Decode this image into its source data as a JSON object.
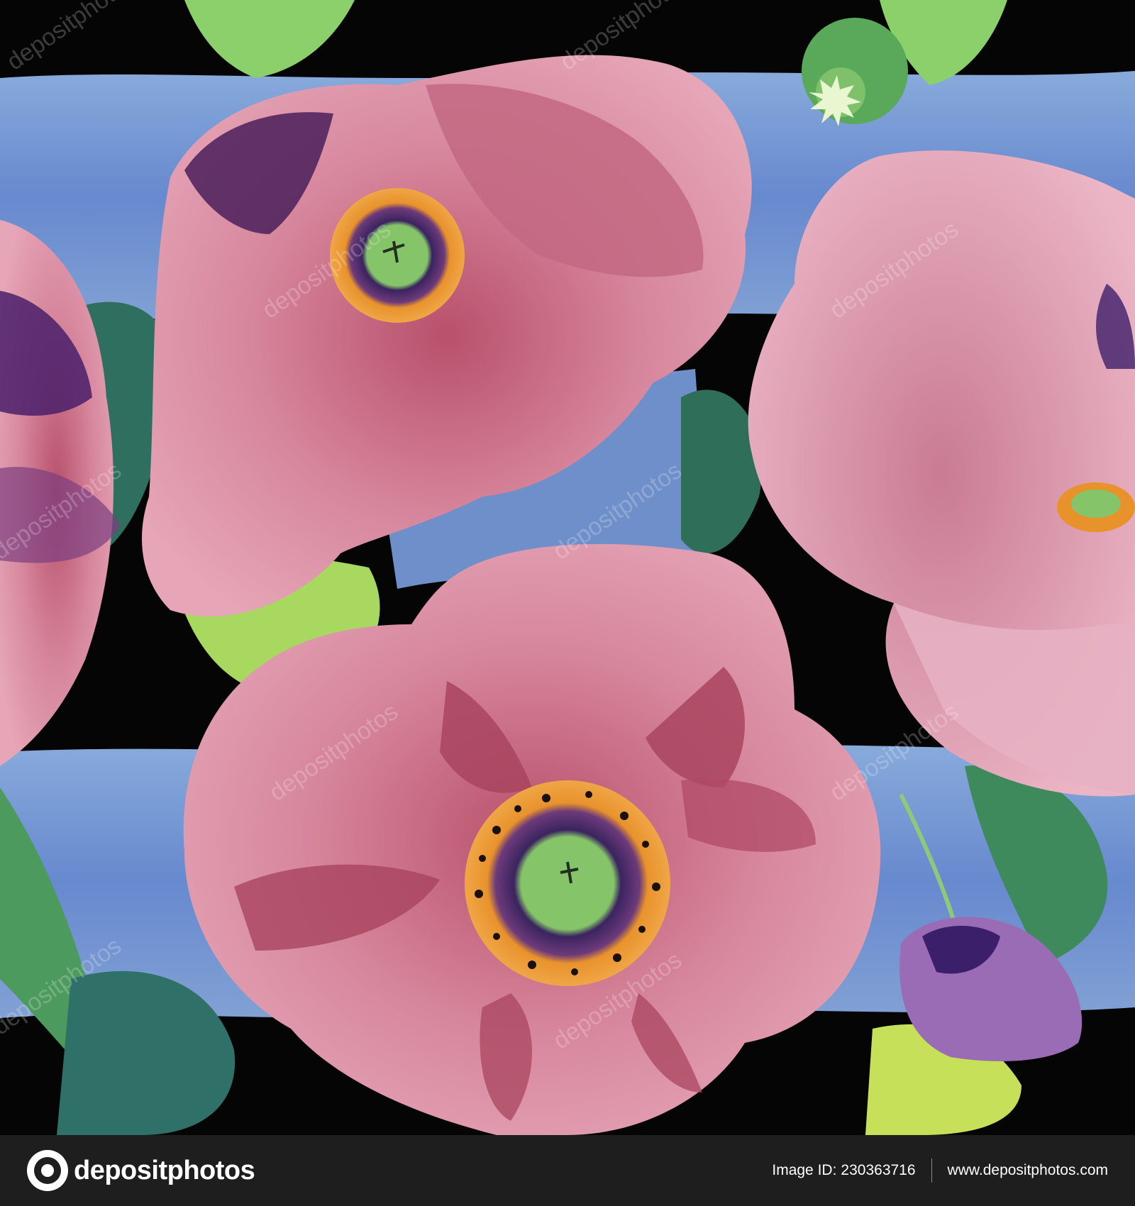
{
  "artwork": {
    "watermark": "depositphotos",
    "colors": {
      "background": "#050505",
      "stripe_blue": "#6f95d8",
      "petal_pink": "#d9889e",
      "petal_dark": "#a8445f",
      "leaf_green": "#3f7a58",
      "bud_green": "#5aa95a",
      "center_orange": "#e8922c",
      "center_green": "#86c46a"
    }
  },
  "footer": {
    "logo_text": "depositphotos",
    "image_id_label": "Image ID:",
    "image_id": "230363716",
    "website": "www.depositphotos.com",
    "background": "#1e1e1e"
  }
}
